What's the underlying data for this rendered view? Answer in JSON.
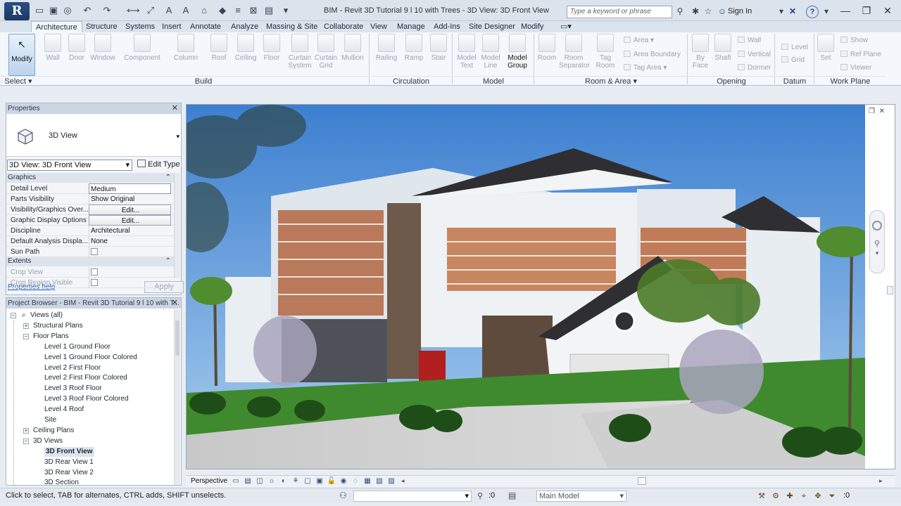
{
  "app": {
    "logo_letter": "R",
    "window_title": "BIM - Revit 3D Tutorial 9 l 10 with Trees - 3D View: 3D Front View",
    "search_placeholder": "Type a keyword or phrase",
    "sign_in": "Sign In",
    "help": "?"
  },
  "tabs": [
    "Architecture",
    "Structure",
    "Systems",
    "Insert",
    "Annotate",
    "Analyze",
    "Massing & Site",
    "Collaborate",
    "View",
    "Manage",
    "Add-Ins",
    "Site Designer",
    "Modify"
  ],
  "active_tab": "Architecture",
  "ribbon": {
    "modify": "Modify",
    "select": "Select",
    "build": [
      "Wall",
      "Door",
      "Window",
      "Component",
      "Column",
      "Roof",
      "Ceiling",
      "Floor",
      "Curtain System",
      "Curtain Grid",
      "Mullion"
    ],
    "circulation": [
      "Railing",
      "Ramp",
      "Stair"
    ],
    "model": [
      "Model Text",
      "Model Line",
      "Model Group"
    ],
    "room": [
      "Room",
      "Room Separator",
      "Tag Room"
    ],
    "room_small": [
      "Area",
      "Area Boundary",
      "Tag Area"
    ],
    "opening": [
      "By Face",
      "Shaft"
    ],
    "opening_small": [
      "Wall",
      "Vertical",
      "Dormer"
    ],
    "datum": [
      "Level",
      "Grid"
    ],
    "workplane": [
      "Set"
    ],
    "workplane_small": [
      "Show",
      "Ref Plane",
      "Viewer"
    ],
    "panels": {
      "select": "Select",
      "build": "Build",
      "circulation": "Circulation",
      "model": "Model",
      "room": "Room & Area",
      "opening": "Opening",
      "datum": "Datum",
      "workplane": "Work Plane"
    }
  },
  "properties": {
    "title": "Properties",
    "type_name": "3D View",
    "view_selector": "3D View: 3D Front View",
    "edit_type": "Edit Type",
    "group_graphics": "Graphics",
    "rows": [
      {
        "k": "Detail Level",
        "v": "Medium",
        "kind": "box"
      },
      {
        "k": "Parts Visibility",
        "v": "Show Original",
        "kind": "text"
      },
      {
        "k": "Visibility/Graphics Over...",
        "v": "Edit...",
        "kind": "btn"
      },
      {
        "k": "Graphic Display Options",
        "v": "Edit...",
        "kind": "btn"
      },
      {
        "k": "Discipline",
        "v": "Architectural",
        "kind": "text"
      },
      {
        "k": "Default Analysis Displa...",
        "v": "None",
        "kind": "text"
      },
      {
        "k": "Sun Path",
        "v": "",
        "kind": "check"
      }
    ],
    "group_extents": "Extents",
    "extent_rows": [
      {
        "k": "Crop View",
        "v": "",
        "kind": "check"
      },
      {
        "k": "Crop Region Visible",
        "v": "",
        "kind": "check"
      }
    ],
    "help_link": "Properties help",
    "apply": "Apply"
  },
  "browser": {
    "title": "Project Browser - BIM - Revit 3D Tutorial 9 l 10 with T...",
    "root": "Views (all)",
    "structural": "Structural Plans",
    "floor": "Floor Plans",
    "floor_items": [
      "Level 1 Ground Floor",
      "Level 1 Ground Floor Colored",
      "Level 2 First Floor",
      "Level 2 First Floor Colored",
      "Level 3 Roof Floor",
      "Level 3 Roof Floor Colored",
      "Level 4 Roof",
      "Site"
    ],
    "ceiling": "Ceiling Plans",
    "views3d": "3D Views",
    "views3d_items": [
      "3D Front View",
      "3D Rear View 1",
      "3D Rear View 2",
      "3D Section"
    ],
    "selected": "3D Front View"
  },
  "viewbar": {
    "mode": "Perspective"
  },
  "status": {
    "message": "Click to select, TAB for alternates, CTRL adds, SHIFT unselects.",
    "count": ":0",
    "model": "Main Model",
    "filter_count": ":0"
  },
  "colors": {
    "accent": "#2a4f86",
    "sky": "#4d8fd6",
    "grass": "#3f8a2e"
  }
}
